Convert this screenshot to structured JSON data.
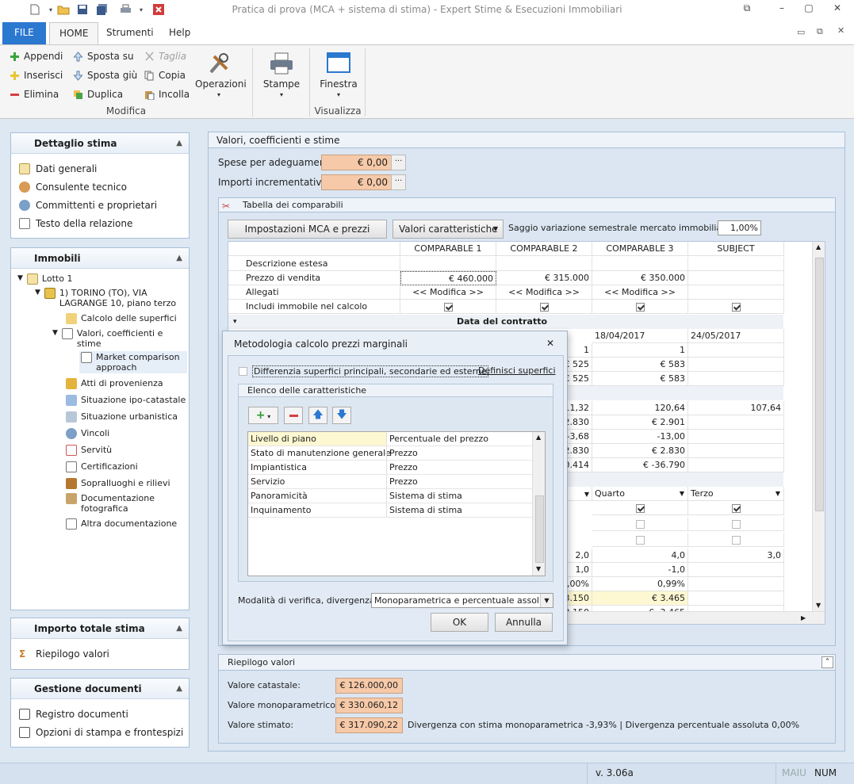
{
  "window": {
    "title": "Pratica di prova (MCA + sistema di stima) - Expert Stime & Esecuzioni Immobiliari",
    "icons": [
      "new-document-icon",
      "open-folder-icon",
      "save-icon",
      "save-all-icon",
      "print-icon",
      "close-red-icon"
    ]
  },
  "ribbon": {
    "tabs": [
      "FILE",
      "HOME",
      "Strumenti",
      "Help"
    ],
    "modifica": {
      "appendi": "Appendi",
      "inserisci": "Inserisci",
      "elimina": "Elimina",
      "sposta_su": "Sposta su",
      "sposta_giu": "Sposta giù",
      "duplica": "Duplica",
      "taglia": "Taglia",
      "copia": "Copia",
      "incolla": "Incolla",
      "operazioni": "Operazioni",
      "group": "Modifica"
    },
    "stampe": "Stampe",
    "finestra": "Finestra",
    "visualizza": "Visualizza"
  },
  "sidebar": {
    "dettaglio": {
      "title": "Dettaglio stima",
      "items": [
        "Dati generali",
        "Consulente tecnico",
        "Committenti e proprietari",
        "Testo della relazione"
      ]
    },
    "immobili": {
      "title": "Immobili",
      "lotto": "Lotto 1",
      "immobile_line1": "1) TORINO (TO), VIA",
      "immobile_line2": "LAGRANGE 10, piano terzo",
      "items": [
        "Calcolo delle superfici",
        "Valori, coefficienti e",
        "stime",
        "Market comparison",
        "approach",
        "Atti di provenienza",
        "Situazione ipo-catastale",
        "Situazione urbanistica",
        "Vincoli",
        "Servitù",
        "Certificazioni",
        "Sopralluoghi e rilievi",
        "Documentazione",
        "fotografica",
        "Altra documentazione"
      ]
    },
    "importo": {
      "title": "Importo totale stima",
      "items": [
        "Riepilogo valori"
      ]
    },
    "gestione": {
      "title": "Gestione documenti",
      "items": [
        "Registro documenti",
        "Opzioni di stampa e frontespizi"
      ]
    }
  },
  "main": {
    "title": "Valori, coefficienti e stime",
    "spese_label": "Spese per adeguamenti:",
    "spese_value": "€ 0,00",
    "importi_label": "Importi incrementativi:",
    "importi_value": "€ 0,00",
    "dots": "···",
    "tabella_title": "Tabella dei comparabili",
    "btn_mca": "Impostazioni MCA e prezzi marginali",
    "select_valori": "Valori caratteristiche",
    "saggio_label": "Saggio variazione semestrale mercato immobiliare:",
    "saggio_value": "1,00%",
    "grid": {
      "headers": [
        "COMPARABLE 1",
        "COMPARABLE 2",
        "COMPARABLE 3",
        "SUBJECT"
      ],
      "descrizione": "Descrizione estesa",
      "prezzo": "Prezzo di vendita",
      "prezzi": [
        "€ 460.000",
        "€ 315.000",
        "€ 350.000"
      ],
      "allegati": "Allegati",
      "modifica": "<< Modifica >>",
      "includi": "Includi immobile nel calcolo",
      "data_contratto": "Data del contratto",
      "date": [
        "18/04/2017",
        "24/05/2017"
      ],
      "c2_values": [
        "1",
        "€ 525",
        "€ 525",
        "11,32",
        "2.830",
        "-3,68",
        "2.830",
        "0.414",
        "2,0",
        "1,0",
        ",00%",
        "3.150",
        "3.150"
      ],
      "c3_values": [
        "1",
        "€ 583",
        "€ 583",
        "120,64",
        "€ 2.901",
        "-13,00",
        "€ 2.830",
        "€ -36.790",
        "4,0",
        "-1,0",
        "0,99%",
        "€ 3.465",
        "€ -3.465"
      ],
      "subj_values": [
        "107,64",
        "3,0"
      ],
      "quarto": "Quarto",
      "terzo": "Terzo"
    },
    "riepilogo": {
      "title": "Riepilogo valori",
      "catastale_label": "Valore catastale:",
      "catastale": "€ 126.000,00",
      "mono_label": "Valore monoparametrico:",
      "mono": "€ 330.060,12",
      "stimato_label": "Valore stimato:",
      "stimato": "€ 317.090,22",
      "divergenza": "Divergenza con stima monoparametrica -3,93% | Divergenza percentuale assoluta 0,00%"
    }
  },
  "dialog": {
    "title": "Metodologia calcolo prezzi marginali",
    "differenzia": "Differenzia superfici principali, secondarie ed esterne",
    "definisci": "Definisci superfici",
    "elenco": "Elenco delle caratteristiche",
    "rows": [
      {
        "name": "Livello di piano",
        "method": "Percentuale del prezzo"
      },
      {
        "name": "Stato di manutenzione generale",
        "method": "Prezzo"
      },
      {
        "name": "Impiantistica",
        "method": "Prezzo"
      },
      {
        "name": "Servizio",
        "method": "Prezzo"
      },
      {
        "name": "Panoramicità",
        "method": "Sistema di stima"
      },
      {
        "name": "Inquinamento",
        "method": "Sistema di stima"
      }
    ],
    "modalita_label": "Modalità di verifica, divergenza:",
    "modalita_value": "Monoparametrica e percentuale assoluta",
    "ok": "OK",
    "annulla": "Annulla"
  },
  "status": {
    "version": "v. 3.06a",
    "maiu": "MAIU",
    "num": "NUM"
  }
}
